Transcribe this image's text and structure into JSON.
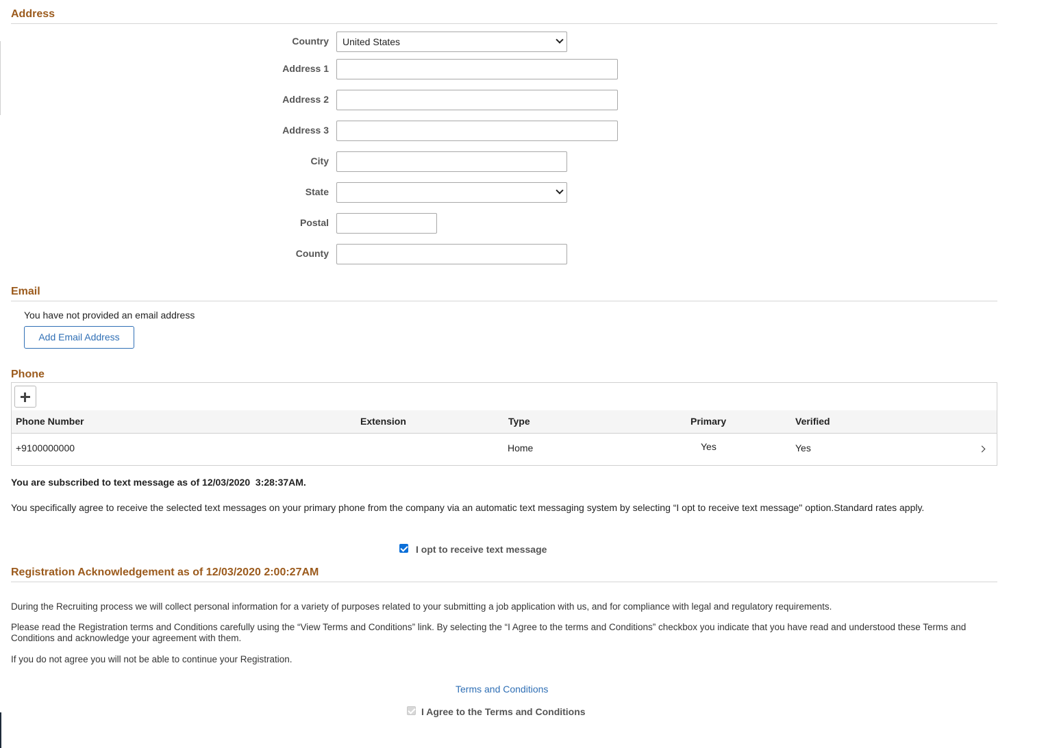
{
  "address": {
    "title": "Address",
    "country_label": "Country",
    "country_value": "United States",
    "address1_label": "Address 1",
    "address1_value": "",
    "address2_label": "Address 2",
    "address2_value": "",
    "address3_label": "Address 3",
    "address3_value": "",
    "city_label": "City",
    "city_value": "",
    "state_label": "State",
    "state_value": "",
    "postal_label": "Postal",
    "postal_value": "",
    "county_label": "County",
    "county_value": ""
  },
  "email": {
    "title": "Email",
    "message": "You have not provided an email address",
    "add_button": "Add Email Address"
  },
  "phone": {
    "title": "Phone",
    "add_icon": "plus-icon",
    "columns": [
      "Phone Number",
      "Extension",
      "Type",
      "Primary",
      "Verified"
    ],
    "rows": [
      {
        "number": "+9100000000",
        "extension": "",
        "type": "Home",
        "primary": "Yes",
        "verified": "Yes"
      }
    ],
    "subscribed_text": "You are subscribed to text message as of 12/03/2020  3:28:37AM.",
    "agree_text": "You specifically agree to receive the selected text messages on your primary phone from the company via an automatic text messaging system by selecting “I opt to receive text message\" option.Standard rates apply.",
    "opt_label": "I opt to receive text message",
    "opt_checked": true
  },
  "registration": {
    "title": "Registration Acknowledgement as of 12/03/2020 2:00:27AM",
    "para1": "During the Recruiting process we will collect personal information for a variety of purposes related to your submitting a job application with us, and for compliance with legal and regulatory requirements.",
    "para2": "Please read the Registration terms and Conditions carefully using the “View Terms and Conditions” link. By selecting the “I Agree to the terms and Conditions” checkbox you indicate that you have read and understood these Terms and Conditions and acknowledge your agreement with them.",
    "para3": "If you do not agree you will not be able to continue your Registration.",
    "terms_link": "Terms and Conditions",
    "agree_label": "I Agree to the Terms and Conditions",
    "agree_checked": true
  },
  "colors": {
    "section_title": "#9b5a1c",
    "link": "#2f6fb5",
    "checkbox": "#0b6fd8"
  }
}
